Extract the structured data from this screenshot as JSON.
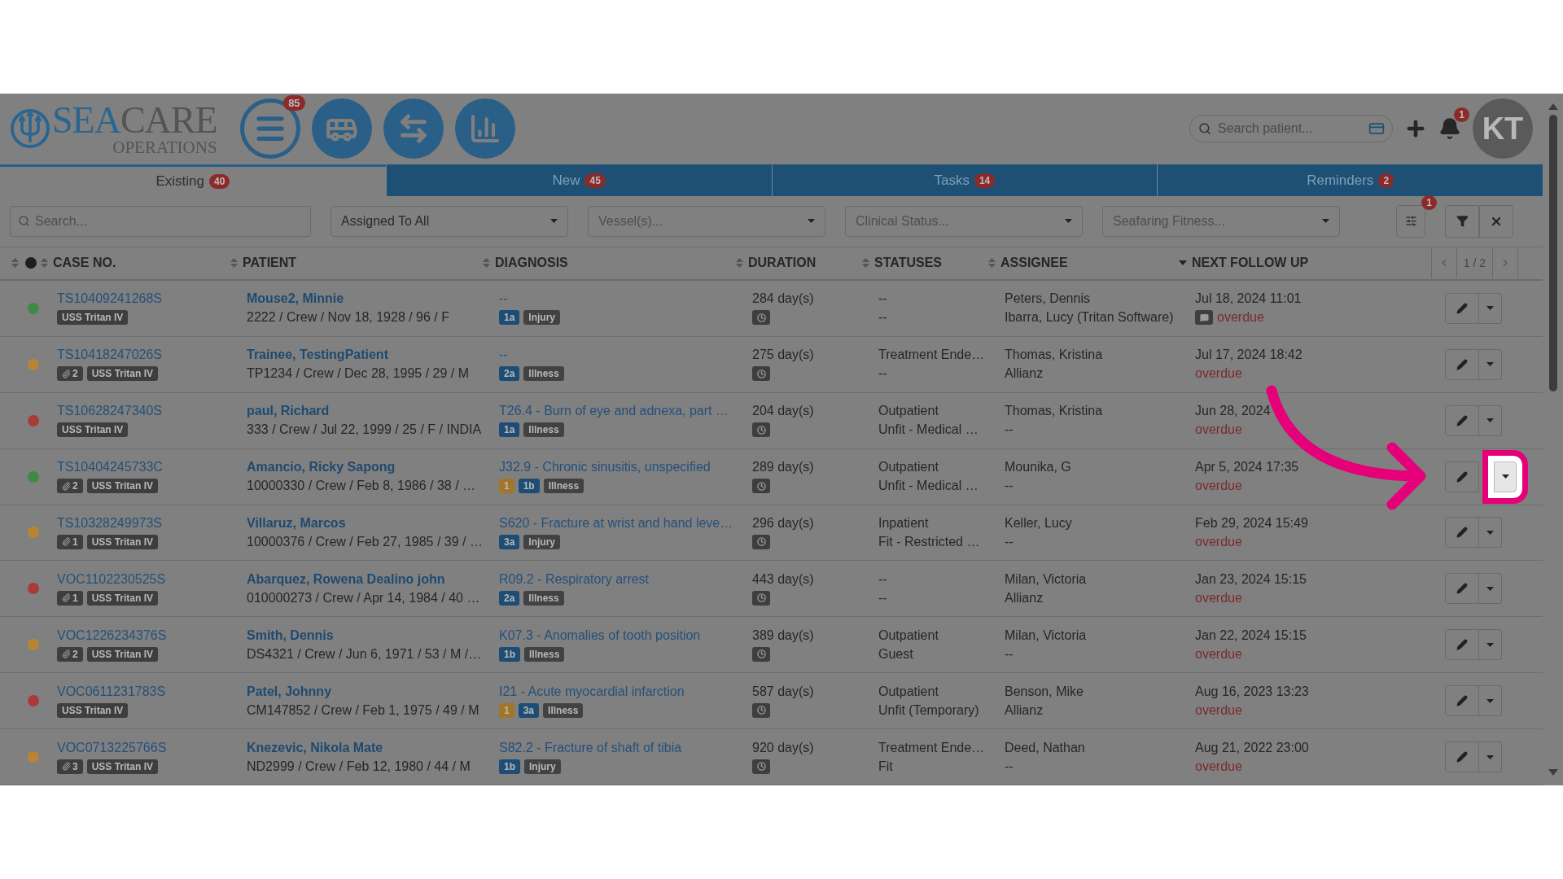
{
  "logo": {
    "part1": "SEA",
    "part2": "CARE",
    "sub": "OPERATIONS"
  },
  "nav_buttons": [
    {
      "kind": "menu",
      "badge": "85"
    },
    {
      "kind": "bus"
    },
    {
      "kind": "transfer"
    },
    {
      "kind": "chart"
    }
  ],
  "patient_search": {
    "placeholder": "Search patient..."
  },
  "notifications": {
    "badge": "1"
  },
  "avatar": {
    "initials": "KT"
  },
  "tabs": [
    {
      "label": "Existing",
      "count": "40",
      "selected": true
    },
    {
      "label": "New",
      "count": "45",
      "selected": false
    },
    {
      "label": "Tasks",
      "count": "14",
      "selected": false
    },
    {
      "label": "Reminders",
      "count": "2",
      "selected": false
    }
  ],
  "filters": {
    "search": {
      "placeholder": "Search..."
    },
    "dropdowns": [
      {
        "value": "Assigned To All"
      },
      {
        "placeholder": "Vessel(s)..."
      },
      {
        "placeholder": "Clinical Status..."
      },
      {
        "placeholder": "Seafaring Fitness..."
      }
    ],
    "settings_badge": "1"
  },
  "table": {
    "columns": [
      {
        "label": "CASE NO.",
        "sorted_desc": false
      },
      {
        "label": "PATIENT",
        "sorted_desc": false
      },
      {
        "label": "DIAGNOSIS",
        "sorted_desc": false
      },
      {
        "label": "DURATION",
        "sorted_desc": false
      },
      {
        "label": "STATUSES",
        "sorted_desc": false
      },
      {
        "label": "ASSIGNEE",
        "sorted_desc": false
      },
      {
        "label": "NEXT FOLLOW UP",
        "sorted_desc": true
      }
    ],
    "pagination": "1 / 2",
    "rows": [
      {
        "color": "#3d8a45",
        "case_no": "TS10409241268S",
        "vessel": "USS Tritan IV",
        "patient": "Mouse2, Minnie",
        "details": "2222 / Crew / Nov 18, 1928 / 96 / F",
        "diagnosis": "--",
        "tags": [
          {
            "kind": "level",
            "text": "1a"
          },
          {
            "kind": "type",
            "text": "Injury"
          }
        ],
        "duration": "284 day(s)",
        "statuses": [
          "--",
          "--"
        ],
        "assignee": [
          "Peters, Dennis",
          "Ibarra, Lucy (Tritan Software)"
        ],
        "follow_up": "Jul 18, 2024 11:01",
        "has_comment": true,
        "follow_status": "overdue",
        "highlighted": false
      },
      {
        "color": "#b98535",
        "case_no": "TS10418247026S",
        "attachments": "2",
        "vessel": "USS Tritan IV",
        "patient": "Trainee, TestingPatient",
        "details": "TP1234 / Crew / Dec 28, 1995 / 29 / M",
        "diagnosis": "--",
        "tags": [
          {
            "kind": "level",
            "text": "2a"
          },
          {
            "kind": "type",
            "text": "Illness"
          }
        ],
        "duration": "275 day(s)",
        "statuses": [
          "Treatment Ende…",
          "--"
        ],
        "assignee": [
          "Thomas, Kristina",
          "Allianz"
        ],
        "follow_up": "Jul 17, 2024 18:42",
        "has_comment": false,
        "follow_status": "overdue",
        "highlighted": false
      },
      {
        "color": "#a83a3a",
        "case_no": "TS10628247340S",
        "vessel": "USS Tritan IV",
        "patient": "paul, Richard",
        "details": "333 / Crew / Jul 22, 1999 / 25 / F / INDIA",
        "diagnosis": "T26.4 - Burn of eye and adnexa, part …",
        "tags": [
          {
            "kind": "level",
            "text": "1a"
          },
          {
            "kind": "type",
            "text": "Illness"
          }
        ],
        "duration": "204 day(s)",
        "statuses": [
          "Outpatient",
          "Unfit - Medical …"
        ],
        "assignee": [
          "Thomas, Kristina",
          "--"
        ],
        "follow_up": "Jun 28, 2024",
        "has_comment": false,
        "follow_status": "overdue",
        "highlighted": false
      },
      {
        "color": "#3d8a45",
        "case_no": "TS10404245733C",
        "attachments": "2",
        "vessel": "USS Tritan IV",
        "patient": "Amancio, Ricky Sapong",
        "details": "10000330 / Crew / Feb 8, 1986 / 38 / …",
        "diagnosis": "J32.9 - Chronic sinusitis, unspecified",
        "tags": [
          {
            "kind": "priority",
            "text": "1"
          },
          {
            "kind": "level",
            "text": "1b"
          },
          {
            "kind": "type",
            "text": "Illness"
          }
        ],
        "duration": "289 day(s)",
        "statuses": [
          "Outpatient",
          "Unfit - Medical …"
        ],
        "assignee": [
          "Mounika, G",
          "--"
        ],
        "follow_up": "Apr 5, 2024 17:35",
        "has_comment": false,
        "follow_status": "overdue",
        "highlighted": true
      },
      {
        "color": "#b98535",
        "case_no": "TS10328249973S",
        "attachments": "1",
        "vessel": "USS Tritan IV",
        "patient": "Villaruz, Marcos",
        "details": "10000376 / Crew / Feb 27, 1985 / 39 / …",
        "diagnosis": "S620 - Fracture at wrist and hand leve…",
        "tags": [
          {
            "kind": "level",
            "text": "3a"
          },
          {
            "kind": "type",
            "text": "Injury"
          }
        ],
        "duration": "296 day(s)",
        "statuses": [
          "Inpatient",
          "Fit - Restricted …"
        ],
        "assignee": [
          "Keller, Lucy",
          "--"
        ],
        "follow_up": "Feb 29, 2024 15:49",
        "has_comment": false,
        "follow_status": "overdue",
        "highlighted": false
      },
      {
        "color": "#a83a3a",
        "case_no": "VOC1102230525S",
        "attachments": "1",
        "vessel": "USS Tritan IV",
        "patient": "Abarquez, Rowena Dealino john",
        "details": "010000273 / Crew / Apr 14, 1984 / 40 …",
        "diagnosis": "R09.2 - Respiratory arrest",
        "tags": [
          {
            "kind": "level",
            "text": "2a"
          },
          {
            "kind": "type",
            "text": "Illness"
          }
        ],
        "duration": "443 day(s)",
        "statuses": [
          "--",
          "--"
        ],
        "assignee": [
          "Milan, Victoria",
          "Allianz"
        ],
        "follow_up": "Jan 23, 2024 15:15",
        "has_comment": false,
        "follow_status": "overdue",
        "highlighted": false
      },
      {
        "color": "#b98535",
        "case_no": "VOC1226234376S",
        "attachments": "2",
        "vessel": "USS Tritan IV",
        "patient": "Smith, Dennis",
        "details": "DS4321 / Crew / Jun 6, 1971 / 53 / M /…",
        "diagnosis": "K07.3 - Anomalies of tooth position",
        "tags": [
          {
            "kind": "level",
            "text": "1b"
          },
          {
            "kind": "type",
            "text": "Illness"
          }
        ],
        "duration": "389 day(s)",
        "statuses": [
          "Outpatient",
          "Guest"
        ],
        "assignee": [
          "Milan, Victoria",
          "--"
        ],
        "follow_up": "Jan 22, 2024 15:15",
        "has_comment": false,
        "follow_status": "overdue",
        "highlighted": false
      },
      {
        "color": "#a83a3a",
        "case_no": "VOC0611231783S",
        "vessel": "USS Tritan IV",
        "patient": "Patel, Johnny",
        "details": "CM147852 / Crew / Feb 1, 1975 / 49 / M",
        "diagnosis": "I21 - Acute myocardial infarction",
        "tags": [
          {
            "kind": "priority",
            "text": "1"
          },
          {
            "kind": "level",
            "text": "3a"
          },
          {
            "kind": "type",
            "text": "Illness"
          }
        ],
        "duration": "587 day(s)",
        "statuses": [
          "Outpatient",
          "Unfit (Temporary)"
        ],
        "assignee": [
          "Benson, Mike",
          "Allianz"
        ],
        "follow_up": "Aug 16, 2023 13:23",
        "has_comment": false,
        "follow_status": "overdue",
        "highlighted": false
      },
      {
        "color": "#b98535",
        "case_no": "VOC0713225766S",
        "attachments": "3",
        "vessel": "USS Tritan IV",
        "patient": "Knezevic, Nikola Mate",
        "details": "ND2999 / Crew / Feb 12, 1980 / 44 / M",
        "diagnosis": "S82.2 - Fracture of shaft of tibia",
        "tags": [
          {
            "kind": "level",
            "text": "1b"
          },
          {
            "kind": "type",
            "text": "Injury"
          }
        ],
        "duration": "920 day(s)",
        "statuses": [
          "Treatment Ende…",
          "Fit"
        ],
        "assignee": [
          "Deed, Nathan",
          "--"
        ],
        "follow_up": "Aug 21, 2022 23:00",
        "has_comment": false,
        "follow_status": "overdue",
        "highlighted": false
      }
    ]
  }
}
